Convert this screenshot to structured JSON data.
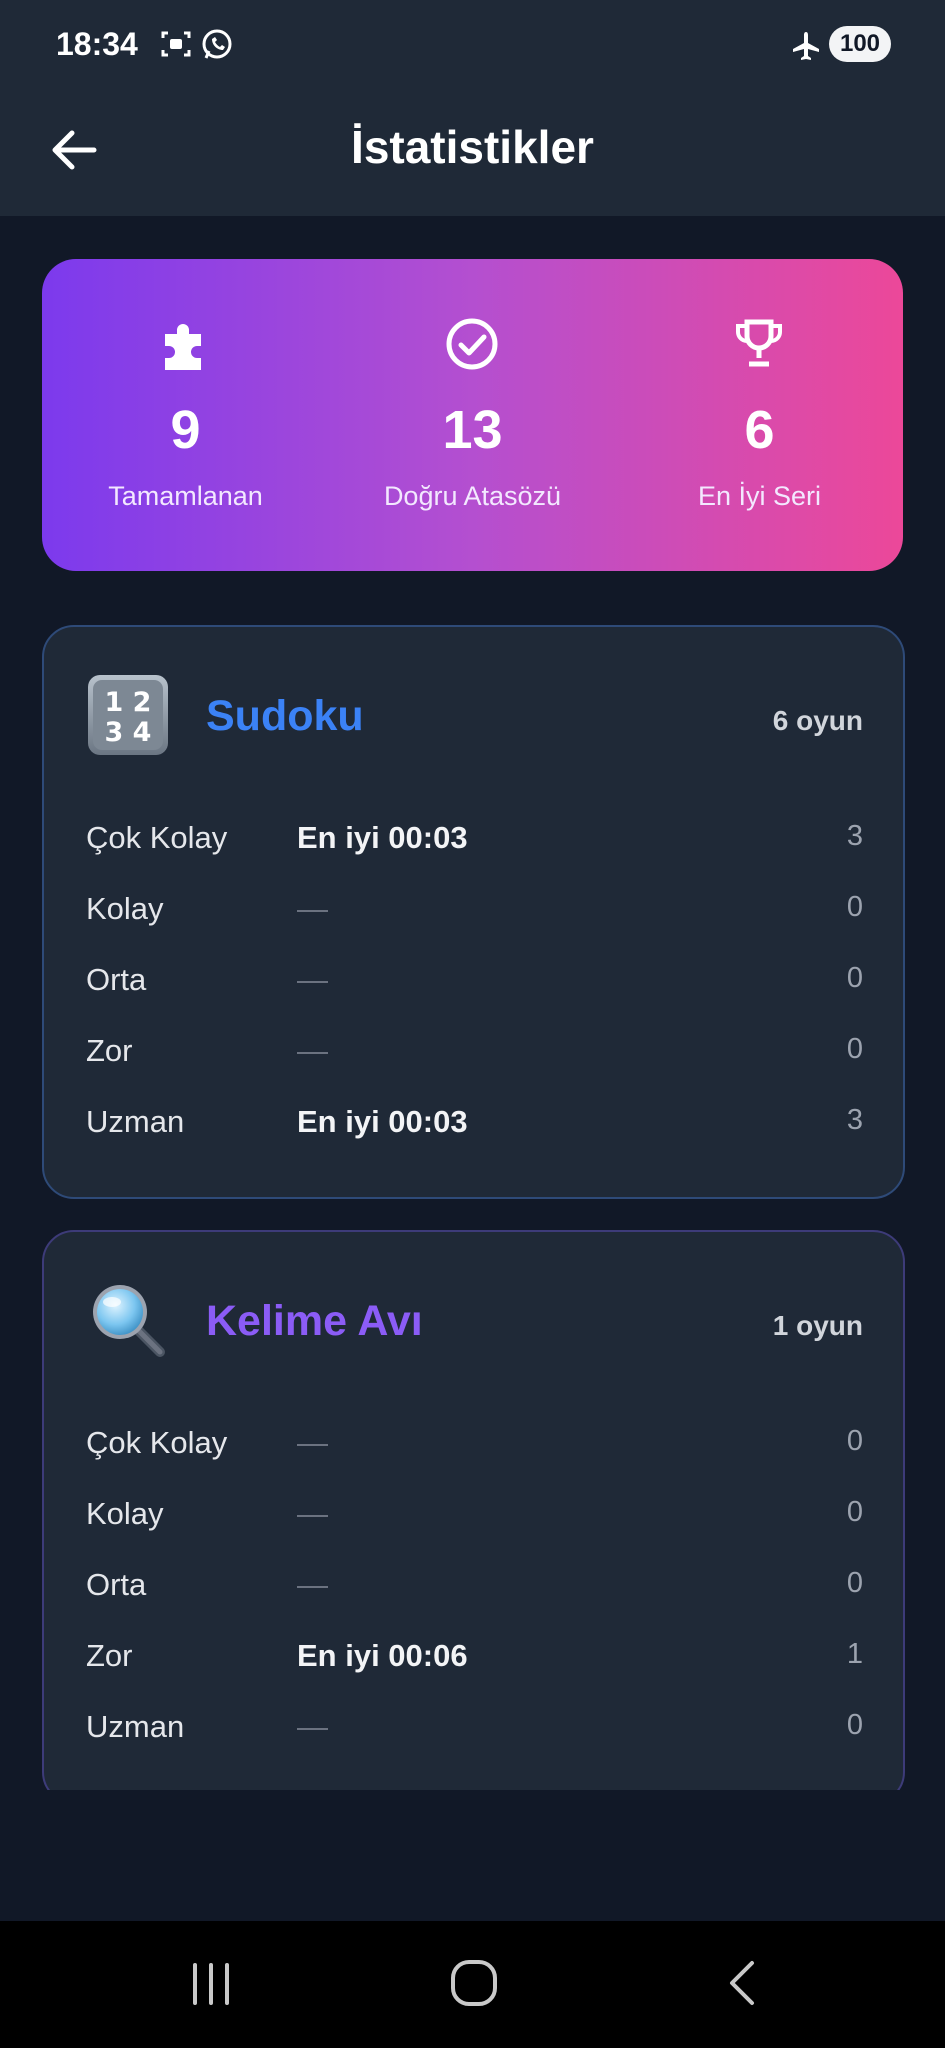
{
  "status_bar": {
    "time": "18:34",
    "battery": "100"
  },
  "app_bar": {
    "title": "İstatistikler"
  },
  "summary": {
    "colors": {
      "start": "#7c3aed",
      "end": "#ec4899"
    },
    "stats": [
      {
        "icon": "puzzle-icon",
        "value": "9",
        "label": "Tamamlanan"
      },
      {
        "icon": "check-circle-icon",
        "value": "13",
        "label": "Doğru Atasözü"
      },
      {
        "icon": "trophy-icon",
        "value": "6",
        "label": "En İyi Seri"
      }
    ]
  },
  "games": [
    {
      "icon": "keycap-1234-icon",
      "title": "Sudoku",
      "title_color": "#3b82f6",
      "count": "6 oyun",
      "rows": [
        {
          "level": "Çok Kolay",
          "best": "En iyi 00:03",
          "count": "3"
        },
        {
          "level": "Kolay",
          "best": "—",
          "count": "0"
        },
        {
          "level": "Orta",
          "best": "—",
          "count": "0"
        },
        {
          "level": "Zor",
          "best": "—",
          "count": "0"
        },
        {
          "level": "Uzman",
          "best": "En iyi 00:03",
          "count": "3"
        }
      ]
    },
    {
      "icon": "magnifying-glass-icon",
      "title": "Kelime Avı",
      "title_color": "#8b5cf6",
      "count": "1 oyun",
      "rows": [
        {
          "level": "Çok Kolay",
          "best": "—",
          "count": "0"
        },
        {
          "level": "Kolay",
          "best": "—",
          "count": "0"
        },
        {
          "level": "Orta",
          "best": "—",
          "count": "0"
        },
        {
          "level": "Zor",
          "best": "En iyi 00:06",
          "count": "1"
        },
        {
          "level": "Uzman",
          "best": "—",
          "count": "0"
        }
      ]
    }
  ]
}
